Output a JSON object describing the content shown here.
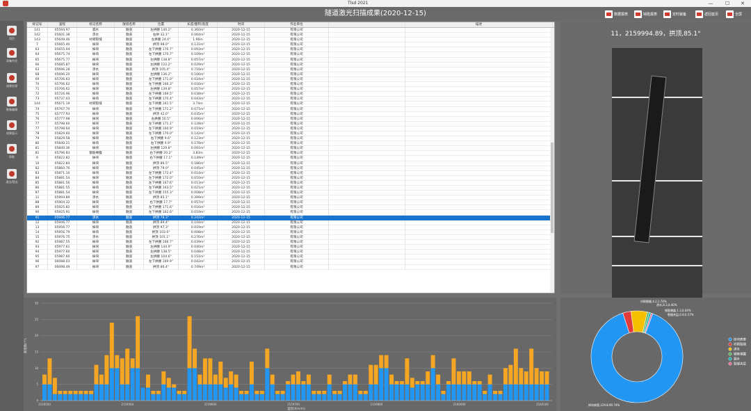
{
  "window": {
    "title": "Tlsd 2021",
    "min": "—",
    "max": "☐",
    "close": "✕"
  },
  "header": {
    "title": "隧道激光扫描成果(2020-12-15)",
    "buttons": [
      {
        "label": "数据报表"
      },
      {
        "label": "缺陷报表"
      },
      {
        "label": "定时装备"
      },
      {
        "label": "返回首页"
      },
      {
        "label": "全屏"
      }
    ]
  },
  "sidebar": {
    "items": [
      {
        "label": "项目"
      },
      {
        "label": "采集作业"
      },
      {
        "label": "成果处理"
      },
      {
        "label": "影像编辑"
      },
      {
        "label": "成果展示"
      },
      {
        "label": "帮助"
      },
      {
        "label": "退出/登出"
      }
    ]
  },
  "table": {
    "headers": [
      "标记号",
      "里程",
      "标记名称",
      "隧道名称",
      "位置",
      "长度/面积/宽度",
      "时间",
      "作业单位",
      "",
      "描述"
    ],
    "selected_index": 38,
    "rows": [
      [
        "141",
        "05594.97",
        "漏水",
        "隧道",
        "左拱腰 140.2°",
        "0.360m²",
        "2020-12-15",
        "有限公司",
        "",
        ""
      ],
      [
        "142",
        "05601.38",
        "渗水",
        "隧道",
        "右拱 32.1°",
        "0.064m²",
        "2020-12-15",
        "有限公司",
        "",
        ""
      ],
      [
        "143",
        "05649.46",
        "衬砌裂缝",
        "隧道",
        "左拱腰 24.0°",
        "1.96m",
        "2020-12-15",
        "有限公司",
        "",
        ""
      ],
      [
        "7",
        "05665.40",
        "掉块",
        "隧道",
        "拱顶 98.0°",
        "0.131m²",
        "2020-12-15",
        "有限公司",
        "",
        ""
      ],
      [
        "63",
        "05655.04",
        "掉块",
        "隧道",
        "左下拱腰 170.7°",
        "0.093m²",
        "2020-12-15",
        "有限公司",
        "",
        ""
      ],
      [
        "64",
        "05675.74",
        "掉块",
        "隧道",
        "左下拱腰 170.7°",
        "0.109m²",
        "2020-12-15",
        "有限公司",
        "",
        ""
      ],
      [
        "65",
        "05675.77",
        "掉块",
        "隧道",
        "左拱腰 138.8°",
        "0.057m²",
        "2020-12-15",
        "有限公司",
        "",
        ""
      ],
      [
        "66",
        "05685.87",
        "掉块",
        "隧道",
        "左拱腰 122.2°",
        "0.029m²",
        "2020-12-15",
        "有限公司",
        "",
        ""
      ],
      [
        "63",
        "05696.28",
        "渗水",
        "隧道",
        "拱顶 105.4°",
        "0.716m²",
        "2020-12-15",
        "有限公司",
        "",
        ""
      ],
      [
        "68",
        "05696.20",
        "掉块",
        "隧道",
        "左拱腰 136.2°",
        "0.106m²",
        "2020-12-15",
        "有限公司",
        "",
        ""
      ],
      [
        "69",
        "05706.63",
        "掉块",
        "隧道",
        "左下拱腰 171.0°",
        "0.024m²",
        "2020-12-15",
        "有限公司",
        "",
        ""
      ],
      [
        "70",
        "05706.62",
        "掉块",
        "隧道",
        "左下拱腰 166.3°",
        "0.016m²",
        "2020-12-15",
        "有限公司",
        "",
        ""
      ],
      [
        "71",
        "05706.62",
        "掉块",
        "隧道",
        "左拱腰 139.8°",
        "0.057m²",
        "2020-12-15",
        "有限公司",
        "",
        ""
      ],
      [
        "72",
        "05726.96",
        "掉块",
        "隧道",
        "左下拱腰 169.5°",
        "0.038m²",
        "2020-12-15",
        "有限公司",
        "",
        ""
      ],
      [
        "73",
        "05737.03",
        "掉块",
        "隧道",
        "左下拱腰 170.4°",
        "0.043m²",
        "2020-12-15",
        "有限公司",
        "",
        ""
      ],
      [
        "144",
        "05671.19",
        "衬砌裂缝",
        "隧道",
        "左下拱腰 161.5°",
        "3.74m",
        "2020-12-15",
        "有限公司",
        "",
        ""
      ],
      [
        "74",
        "05767.70",
        "掉块",
        "隧道",
        "左下拱腰 171.2°",
        "0.071m²",
        "2020-12-15",
        "有限公司",
        "",
        ""
      ],
      [
        "75",
        "05777.93",
        "掉块",
        "隧道",
        "拱顶 42.0°",
        "0.035m²",
        "2020-12-15",
        "有限公司",
        "",
        ""
      ],
      [
        "76",
        "05777.98",
        "掉块",
        "隧道",
        "右拱腰 50.5°",
        "0.006m²",
        "2020-12-15",
        "有限公司",
        "",
        ""
      ],
      [
        "77",
        "05798.60",
        "掉块",
        "隧道",
        "左下拱腰 171.1°",
        "0.128m²",
        "2020-12-15",
        "有限公司",
        "",
        ""
      ],
      [
        "77",
        "05798.64",
        "掉块",
        "隧道",
        "左下拱腰 160.9°",
        "0.019m²",
        "2020-12-15",
        "有限公司",
        "",
        ""
      ],
      [
        "78",
        "05829.60",
        "掉块",
        "隧道",
        "左下拱腰 170.0°",
        "0.142m²",
        "2020-12-15",
        "有限公司",
        "",
        ""
      ],
      [
        "79",
        "05829.58",
        "掉块",
        "隧道",
        "右下拱腰 9.6°",
        "0.123m²",
        "2020-12-15",
        "有限公司",
        "",
        ""
      ],
      [
        "80",
        "05840.21",
        "掉块",
        "隧道",
        "右下拱腰 0.9°",
        "0.178m²",
        "2020-12-15",
        "有限公司",
        "",
        ""
      ],
      [
        "81",
        "05840.36",
        "掉块",
        "隧道",
        "左拱腰 129.8°",
        "0.091m²",
        "2020-12-15",
        "有限公司",
        "",
        ""
      ],
      [
        "81",
        "05796.83",
        "钢筋裸露",
        "隧道",
        "右下拱腰 20.2°",
        "3.83m",
        "2020-12-15",
        "有限公司",
        "",
        ""
      ],
      [
        "9",
        "05822.82",
        "掉块",
        "隧道",
        "右下拱腰 17.1°",
        "0.149m²",
        "2020-12-15",
        "有限公司",
        "",
        ""
      ],
      [
        "10",
        "05822.84",
        "掉块",
        "隧道",
        "拱顶 86.5°",
        "0.186m²",
        "2020-12-15",
        "有限公司",
        "",
        ""
      ],
      [
        "82",
        "05860.76",
        "掉块",
        "隧道",
        "拱顶 79.0°",
        "0.045m²",
        "2020-12-15",
        "有限公司",
        "",
        ""
      ],
      [
        "83",
        "05871.10",
        "掉块",
        "隧道",
        "左下拱腰 172.4°",
        "0.014m²",
        "2020-12-15",
        "有限公司",
        "",
        ""
      ],
      [
        "84",
        "05881.54",
        "掉块",
        "隧道",
        "左下拱腰 172.0°",
        "0.010m²",
        "2020-12-15",
        "有限公司",
        "",
        ""
      ],
      [
        "85",
        "05881.56",
        "掉块",
        "隧道",
        "左下拱腰 167.6°",
        "0.013m²",
        "2020-12-15",
        "有限公司",
        "",
        ""
      ],
      [
        "86",
        "05881.55",
        "掉块",
        "隧道",
        "左下拱腰 163.5°",
        "0.021m²",
        "2020-12-15",
        "有限公司",
        "",
        ""
      ],
      [
        "87",
        "05881.54",
        "掉块",
        "隧道",
        "左下拱腰 155.3°",
        "0.008m²",
        "2020-12-15",
        "有限公司",
        "",
        ""
      ],
      [
        "11",
        "05994.89",
        "渗水",
        "隧道",
        "拱顶 85.1°",
        "0.399m²",
        "2020-12-15",
        "有限公司",
        "",
        ""
      ],
      [
        "88",
        "05904.32",
        "掉块",
        "隧道",
        "右下拱腰 17.7°",
        "0.057m²",
        "2020-12-15",
        "有限公司",
        "",
        ""
      ],
      [
        "89",
        "05925.82",
        "掉块",
        "隧道",
        "左下拱腰 171.6°",
        "0.016m²",
        "2020-12-15",
        "有限公司",
        "",
        ""
      ],
      [
        "90",
        "05925.91",
        "掉块",
        "隧道",
        "左下拱腰 162.6°",
        "0.019m²",
        "2020-12-15",
        "有限公司",
        "",
        ""
      ],
      [
        "91",
        "05946.77",
        "渗水",
        "隧道",
        "拱顶 78.3°",
        "0.242m²",
        "2020-12-15",
        "有限公司",
        "",
        ""
      ],
      [
        "12",
        "05946.77",
        "掉块",
        "隧道",
        "拱顶 89.4°",
        "0.104m²",
        "2020-12-15",
        "有限公司",
        "",
        ""
      ],
      [
        "13",
        "05956.77",
        "掉块",
        "隧道",
        "拱顶 97.3°",
        "0.019m²",
        "2020-12-15",
        "有限公司",
        "",
        ""
      ],
      [
        "14",
        "05956.79",
        "掉块",
        "隧道",
        "拱顶 103.6°",
        "0.008m²",
        "2020-12-15",
        "有限公司",
        "",
        ""
      ],
      [
        "15",
        "05976.75",
        "渗水",
        "隧道",
        "拱顶 101.1°",
        "0.276m²",
        "2020-12-15",
        "有限公司",
        "",
        ""
      ],
      [
        "92",
        "05987.55",
        "掉块",
        "隧道",
        "左下拱腰 166.7°",
        "0.039m²",
        "2020-12-15",
        "有限公司",
        "",
        ""
      ],
      [
        "93",
        "05977.61",
        "掉块",
        "隧道",
        "左拱腰 144.9°",
        "0.040m²",
        "2020-12-15",
        "有限公司",
        "",
        ""
      ],
      [
        "94",
        "05977.60",
        "掉块",
        "隧道",
        "左拱腰 138.5°",
        "0.048m²",
        "2020-12-15",
        "有限公司",
        "",
        ""
      ],
      [
        "95",
        "05987.60",
        "掉块",
        "隧道",
        "左拱腰 104.6°",
        "0.151m²",
        "2020-12-15",
        "有限公司",
        "",
        ""
      ],
      [
        "96",
        "06088.03",
        "掉块",
        "隧道",
        "左下拱腰 169.9°",
        "0.042m²",
        "2020-12-15",
        "有限公司",
        "",
        ""
      ],
      [
        "97",
        "06098.49",
        "掉块",
        "隧道",
        "拱顶 86.4°",
        "0.749m²",
        "2020-12-15",
        "有限公司",
        "",
        ""
      ]
    ]
  },
  "image_panel": {
    "title": "11，2159994.89，拱顶,85.1°"
  },
  "chart_data": [
    {
      "type": "bar",
      "xlabel": "里程(Km/m)",
      "ylabel": "病害数(个)",
      "ylim": [
        0,
        30
      ],
      "xticks": [
        "2159500",
        "2159560",
        "2159600",
        "2159700",
        "2159800",
        "2160000",
        "2160100"
      ],
      "series": [
        {
          "name": "掉块",
          "color": "#2196f3",
          "values": [
            5,
            5,
            2,
            2,
            2,
            2,
            2,
            2,
            2,
            2,
            5,
            5,
            5,
            10,
            10,
            5,
            5,
            10,
            10,
            4,
            4,
            2,
            2,
            5,
            4,
            4,
            2,
            2,
            10,
            10,
            5,
            5,
            5,
            5,
            5,
            4,
            5,
            4,
            2,
            2,
            5,
            2,
            2,
            10,
            5,
            2,
            2,
            5,
            5,
            5,
            5,
            5,
            2,
            2,
            2,
            5,
            2,
            2,
            5,
            5,
            5,
            2,
            2,
            5,
            5,
            10,
            10,
            5,
            5,
            5,
            5,
            4,
            5,
            5,
            5,
            10,
            5,
            2,
            5,
            5,
            5,
            5,
            5,
            5,
            5,
            2,
            5,
            2,
            2,
            5,
            5,
            5,
            5,
            5,
            5,
            5,
            5,
            5
          ]
        },
        {
          "name": "漏水",
          "color": "#f5a623",
          "values": [
            3,
            8,
            5,
            1,
            1,
            1,
            1,
            1,
            1,
            1,
            6,
            3,
            9,
            14,
            4,
            8,
            11,
            3,
            16,
            0,
            4,
            1,
            1,
            4,
            3,
            1,
            1,
            1,
            16,
            6,
            3,
            8,
            8,
            3,
            7,
            3,
            4,
            4,
            1,
            1,
            7,
            1,
            1,
            6,
            3,
            1,
            1,
            1,
            3,
            4,
            1,
            3,
            1,
            1,
            1,
            3,
            1,
            1,
            1,
            3,
            3,
            1,
            1,
            6,
            6,
            4,
            4,
            3,
            1,
            1,
            8,
            3,
            1,
            1,
            4,
            4,
            3,
            1,
            1,
            8,
            4,
            4,
            4,
            1,
            1,
            1,
            3,
            1,
            1,
            5,
            6,
            11,
            5,
            4,
            11,
            5,
            4,
            4
          ]
        }
      ]
    },
    {
      "type": "pie",
      "slices": [
        {
          "label": "掉块",
          "value": 129.8,
          "color": "#2196f3"
        },
        {
          "label": "衬砌裂缝",
          "value": 4.2,
          "color": "#e23b3b"
        },
        {
          "label": "渗水",
          "value": 8.3,
          "color": "#f5c000"
        },
        {
          "label": "钢筋裸露",
          "value": 1.0,
          "color": "#5bb55b"
        },
        {
          "label": "漏水",
          "value": 1.0,
          "color": "#1ab4b4"
        },
        {
          "label": "裂缝夹层",
          "value": 0.8,
          "color": "#e86a8a"
        }
      ],
      "labels": {
        "a": "衬砌裂缝,4.2,1.74%",
        "b": "渗水,8.3,4.40%",
        "c": "钢筋裸露,1.3,0.64%",
        "d": "裂缝夹层,0.8,0.57%",
        "main": "掉块病害,129.8,90.74%"
      },
      "legend": [
        "掉块病害",
        "衬砌裂缝",
        "渗水",
        "钢筋裸露",
        "漏水",
        "裂缝夹层"
      ]
    }
  ]
}
